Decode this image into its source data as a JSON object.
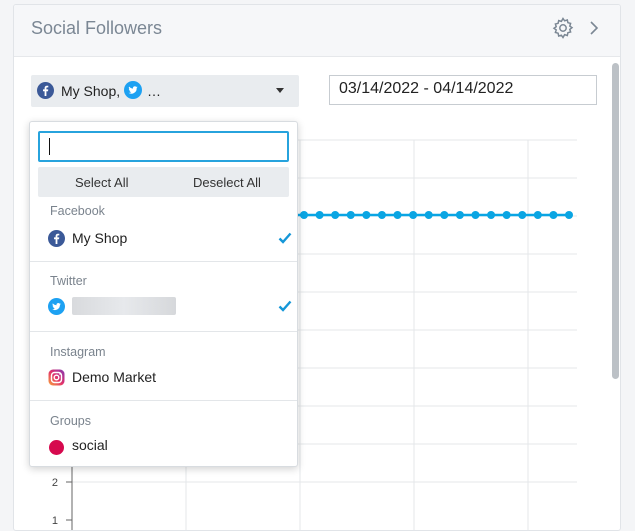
{
  "widget": {
    "title": "Social Followers"
  },
  "filters": {
    "selected_summary": "My Shop,",
    "selected_more": "…",
    "date_range": "03/14/2022 - 04/14/2022"
  },
  "dropdown": {
    "search_value": "",
    "select_all_label": "Select All",
    "deselect_all_label": "Deselect All",
    "groups": [
      {
        "label": "Facebook",
        "items": [
          {
            "name": "My Shop",
            "icon": "facebook-icon",
            "checked": true
          }
        ]
      },
      {
        "label": "Twitter",
        "items": [
          {
            "name": "",
            "icon": "twitter-icon",
            "checked": true
          }
        ]
      },
      {
        "label": "Instagram",
        "items": [
          {
            "name": "Demo Market",
            "icon": "instagram-icon",
            "checked": false
          }
        ]
      },
      {
        "label": "Groups",
        "items": [
          {
            "name": "social",
            "icon": "group-dot-icon",
            "checked": false
          }
        ]
      }
    ]
  },
  "chart_data": {
    "type": "line",
    "y_ticks": [
      "2",
      "1"
    ],
    "series": [
      {
        "color": "#0aa5e3",
        "points_visible": 18
      }
    ]
  },
  "colors": {
    "accent": "#27a3dd",
    "line": "#0aa5e3",
    "facebook": "#3b5998",
    "twitter": "#1da1f2",
    "group": "#d6094e"
  }
}
